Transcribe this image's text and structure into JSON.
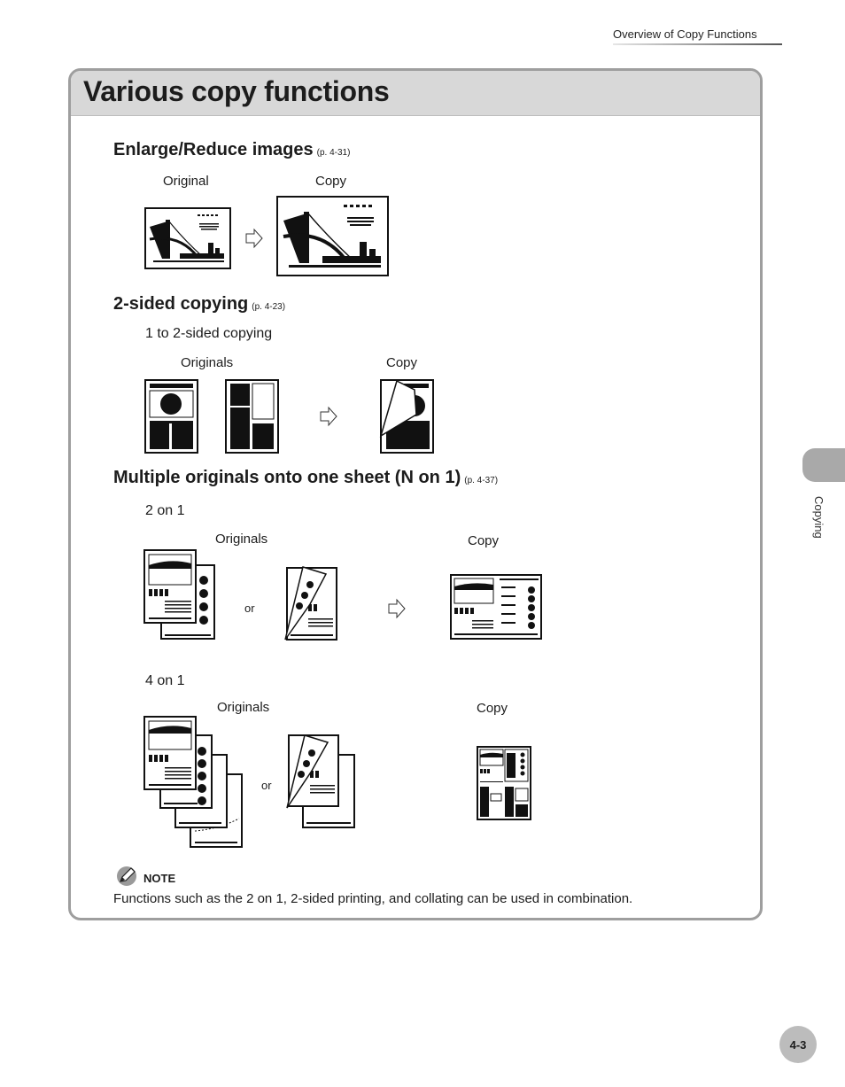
{
  "header": {
    "running_title": "Overview of Copy Functions"
  },
  "page": {
    "title": "Various copy functions",
    "sections": [
      {
        "heading": "Enlarge/Reduce images",
        "ref": "(p. 4-31)",
        "labels": {
          "original": "Original",
          "copy": "Copy"
        }
      },
      {
        "heading": "2-sided copying",
        "ref": "(p. 4-23)",
        "subheading": "1 to 2-sided copying",
        "labels": {
          "originals": "Originals",
          "copy": "Copy"
        }
      },
      {
        "heading": "Multiple originals onto one sheet (N on 1)",
        "ref": "(p. 4-37)",
        "subsections": [
          {
            "subheading": "2 on 1",
            "originals": "Originals",
            "or": "or",
            "copy": "Copy"
          },
          {
            "subheading": "4 on 1",
            "originals": "Originals",
            "or": "or",
            "copy": "Copy"
          }
        ]
      }
    ],
    "note": {
      "icon": "pencil-icon",
      "label": "NOTE",
      "text": "Functions such as the 2 on 1, 2-sided printing, and collating can be used in combination."
    }
  },
  "side_tab": {
    "label": "Copying"
  },
  "footer": {
    "page_number": "4-3"
  }
}
